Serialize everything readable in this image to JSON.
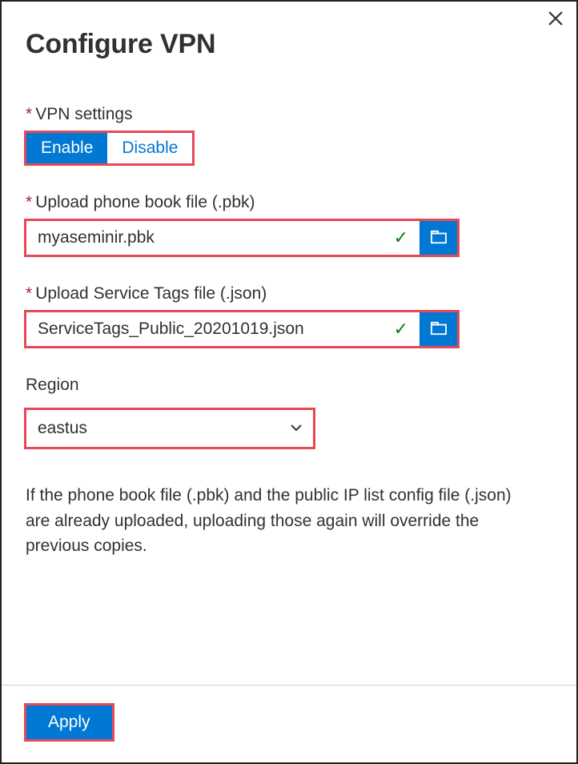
{
  "header": {
    "title": "Configure VPN"
  },
  "vpn_settings": {
    "label": "VPN settings",
    "enable_label": "Enable",
    "disable_label": "Disable",
    "selected": "Enable"
  },
  "phone_book": {
    "label": "Upload phone book file (.pbk)",
    "value": "myaseminir.pbk",
    "status": "valid"
  },
  "service_tags": {
    "label": "Upload Service Tags file (.json)",
    "value": "ServiceTags_Public_20201019.json",
    "status": "valid"
  },
  "region": {
    "label": "Region",
    "selected": "eastus"
  },
  "help_text": "If the phone book file (.pbk) and the public IP list config file (.json) are already uploaded, uploading those again will override the previous copies.",
  "footer": {
    "apply_label": "Apply"
  },
  "icons": {
    "close": "close-icon",
    "checkmark": "check-icon",
    "folder": "folder-icon",
    "chevron_down": "chevron-down-icon"
  },
  "colors": {
    "primary": "#0078d4",
    "required": "#a4262c",
    "highlight": "#e74856",
    "success": "#107c10",
    "text": "#323130"
  }
}
